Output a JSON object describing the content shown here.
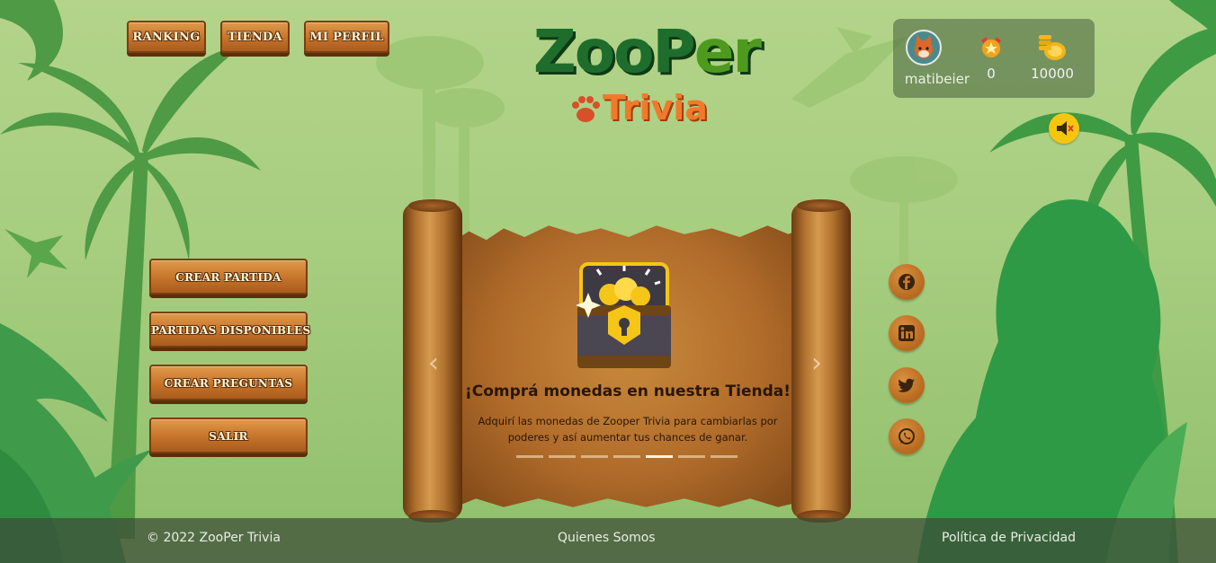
{
  "nav": {
    "ranking_label": "RANKING",
    "tienda_label": "TIENDA",
    "perfil_label": "MI PERFIL"
  },
  "logo": {
    "main_part1": "ZooP",
    "main_part2": "er",
    "sub": "Trivia"
  },
  "user": {
    "name": "matibeier",
    "trophies": "0",
    "coins": "10000"
  },
  "menu": {
    "items": [
      {
        "label": "CREAR PARTIDA"
      },
      {
        "label": "PARTIDAS DISPONIBLES"
      },
      {
        "label": "CREAR PREGUNTAS"
      },
      {
        "label": "SALIR"
      }
    ]
  },
  "carousel": {
    "title": "¡Comprá monedas en nuestra Tienda!",
    "text": "Adquirí las monedas de Zooper Trivia para cambiarlas por poderes y así aumentar tus chances de ganar.",
    "active_slide": 5,
    "slide_count": 7,
    "prev_arrow": "‹",
    "next_arrow": "›"
  },
  "social": [
    "facebook-icon",
    "linkedin-icon",
    "twitter-icon",
    "whatsapp-icon"
  ],
  "footer": {
    "copyright": "© 2022 ZooPer Trivia",
    "about": "Quienes Somos",
    "privacy": "Política de Privacidad"
  },
  "colors": {
    "wood": "#c6732a",
    "sound": "#f6c60e",
    "logo_green": "#1f6d2c",
    "logo_orange": "#f07a2a"
  }
}
